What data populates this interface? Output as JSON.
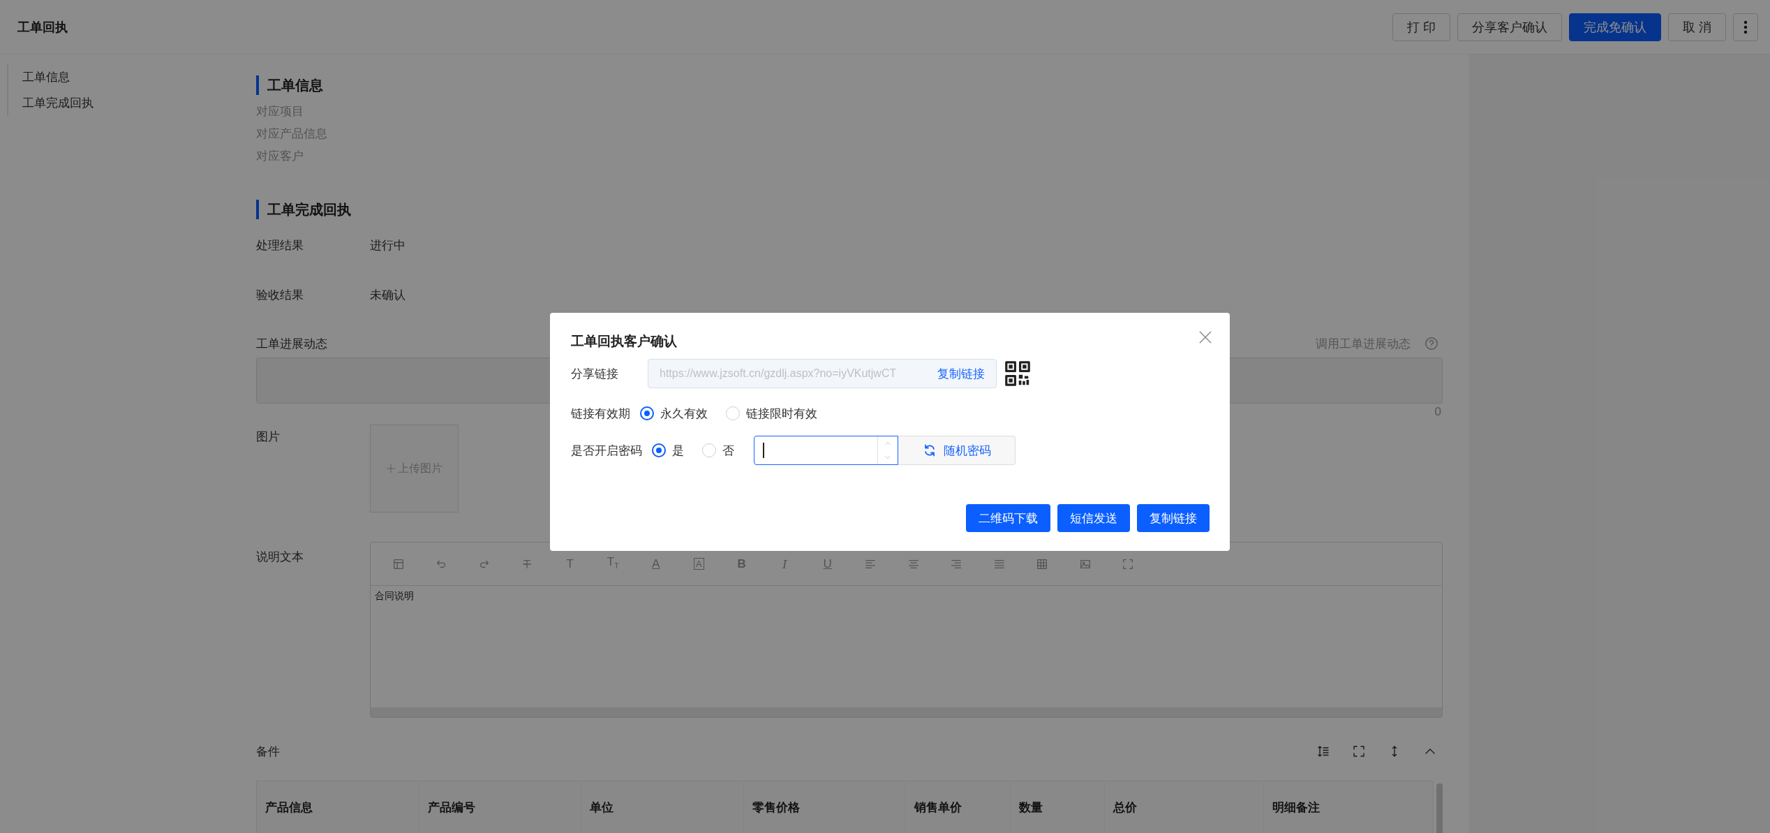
{
  "header": {
    "title": "工单回执",
    "buttons": [
      {
        "kind": "default",
        "label": "打 印"
      },
      {
        "kind": "default",
        "label": "分享客户确认"
      },
      {
        "kind": "primary",
        "label": "完成免确认"
      },
      {
        "kind": "default",
        "label": "取 消"
      },
      {
        "kind": "more"
      }
    ]
  },
  "sidebar": {
    "items": [
      {
        "label": "工单信息"
      },
      {
        "label": "工单完成回执"
      }
    ]
  },
  "info_section": {
    "title": "工单信息",
    "items": [
      "对应项目",
      "对应产品信息",
      "对应客户"
    ]
  },
  "completion_section": {
    "title": "工单完成回执",
    "fields": [
      {
        "label": "处理结果",
        "value": "进行中"
      },
      {
        "label": "验收结果",
        "value": "未确认"
      }
    ],
    "progress": {
      "label": "工单进展动态",
      "action": "调用工单进展动态",
      "count": "0"
    },
    "images": {
      "label": "图片",
      "upload": "上传图片"
    },
    "description": {
      "label": "说明文本",
      "content": "合同说明",
      "toolbar": [
        {
          "kind": "layout"
        },
        {
          "kind": "undo"
        },
        {
          "kind": "redo"
        },
        {
          "kind": "strike"
        },
        {
          "kind": "plain-letter",
          "text": "T"
        },
        {
          "kind": "sized-letter",
          "text": "T$_{T}$"
        },
        {
          "kind": "underlined-letter",
          "text": "A"
        },
        {
          "kind": "boxed-letter",
          "text": "A"
        },
        {
          "kind": "bold-letter",
          "text": "B"
        },
        {
          "kind": "italic-letter",
          "text": "I"
        },
        {
          "kind": "underlined-letter",
          "text": "U"
        },
        {
          "kind": "align-left"
        },
        {
          "kind": "align-center"
        },
        {
          "kind": "align-right"
        },
        {
          "kind": "justify"
        },
        {
          "kind": "table"
        },
        {
          "kind": "image"
        },
        {
          "kind": "fullscreen"
        }
      ]
    }
  },
  "parts": {
    "title": "备件",
    "tools": [
      {
        "kind": "line-height"
      },
      {
        "kind": "fullscreen"
      },
      {
        "kind": "resize"
      },
      {
        "kind": "collapse"
      }
    ],
    "columns": [
      "产品信息",
      "产品编号",
      "单位",
      "零售价格",
      "销售单价",
      "数量",
      "总价",
      "明细备注"
    ]
  },
  "dialog": {
    "title": "工单回执客户确认",
    "share_link": {
      "label": "分享链接",
      "url": "https://www.jzsoft.cn/gzdlj.aspx?no=iyVKutjwCT",
      "copy": "复制链接"
    },
    "validity": {
      "label": "链接有效期",
      "options": [
        {
          "label": "永久有效",
          "selected": true
        },
        {
          "label": "链接限时有效",
          "selected": false
        }
      ]
    },
    "password": {
      "label": "是否开启密码",
      "options": [
        {
          "label": "是",
          "selected": true
        },
        {
          "label": "否",
          "selected": false
        }
      ],
      "random": "随机密码"
    },
    "buttons": [
      "二维码下载",
      "短信发送",
      "复制链接"
    ]
  }
}
